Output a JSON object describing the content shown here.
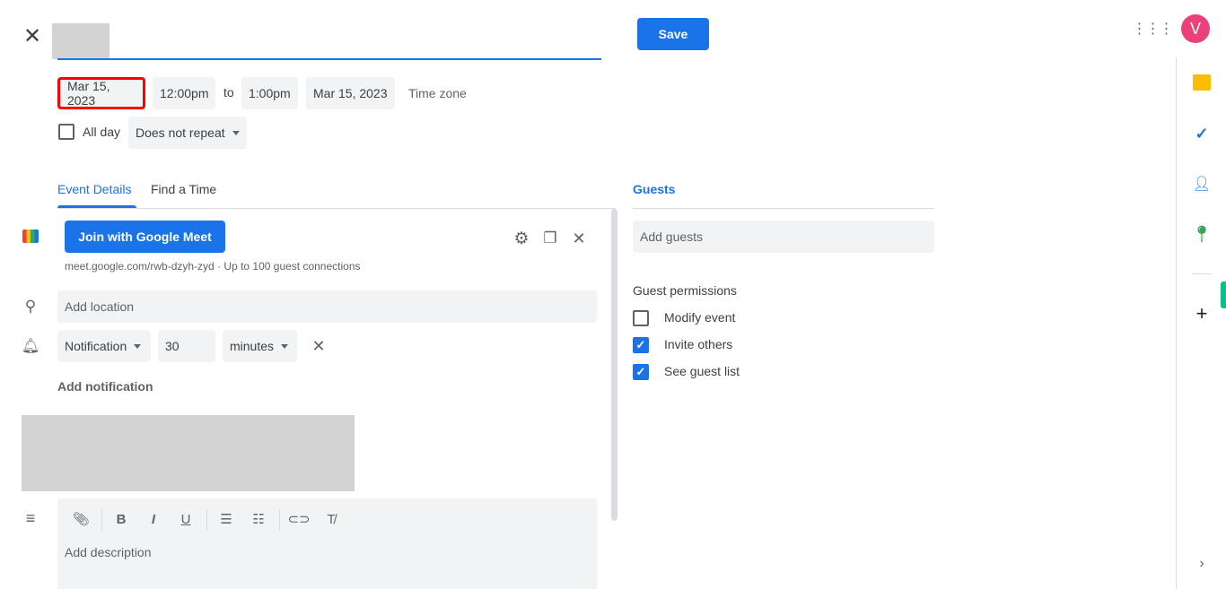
{
  "header": {
    "save_label": "Save",
    "avatar_letter": "V"
  },
  "datetime": {
    "start_date": "Mar 15, 2023",
    "start_time": "12:00pm",
    "to": "to",
    "end_time": "1:00pm",
    "end_date": "Mar 15, 2023",
    "time_zone": "Time zone",
    "all_day": "All day",
    "repeat": "Does not repeat"
  },
  "tabs": [
    {
      "label": "Event Details",
      "active": true
    },
    {
      "label": "Find a Time",
      "active": false
    }
  ],
  "meet": {
    "button": "Join with Google Meet",
    "link": "meet.google.com/rwb-dzyh-zyd · Up to 100 guest connections"
  },
  "location": {
    "placeholder": "Add location"
  },
  "notification": {
    "type": "Notification",
    "value": "30",
    "unit": "minutes",
    "add": "Add notification"
  },
  "description": {
    "placeholder": "Add description"
  },
  "guests": {
    "title": "Guests",
    "placeholder": "Add guests",
    "permissions_title": "Guest permissions",
    "permissions": [
      {
        "label": "Modify event",
        "checked": false
      },
      {
        "label": "Invite others",
        "checked": true
      },
      {
        "label": "See guest list",
        "checked": true
      }
    ]
  },
  "colors": {
    "accent": "#1a73e8",
    "highlight": "#ff0000",
    "avatar": "#ec407a"
  }
}
